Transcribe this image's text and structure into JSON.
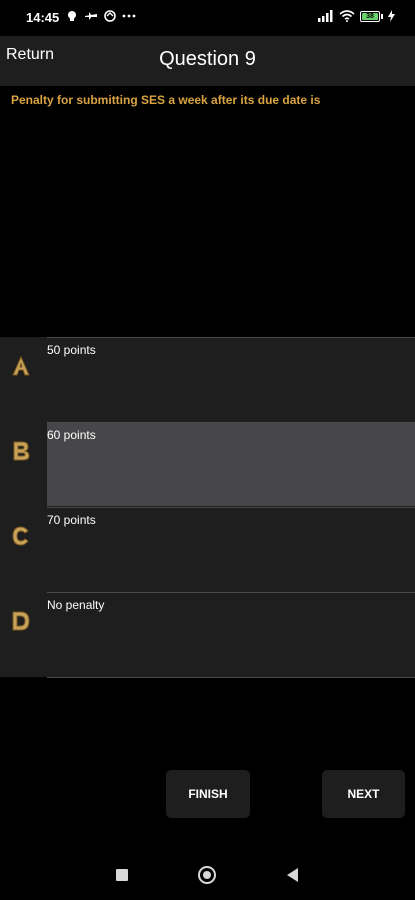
{
  "status_bar": {
    "time": "14:45",
    "battery_level": "38",
    "icons": [
      "notification-icon",
      "airplane-icon",
      "sync-icon",
      "more-icon",
      "signal-icon",
      "wifi-icon",
      "battery-icon",
      "charging-icon"
    ]
  },
  "header": {
    "return_label": "Return",
    "title": "Question 9"
  },
  "question": {
    "text": "Penalty for submitting SES a week after its due date is"
  },
  "answers": [
    {
      "letter": "A",
      "label": "50 points",
      "selected": false
    },
    {
      "letter": "B",
      "label": "60 points",
      "selected": true
    },
    {
      "letter": "C",
      "label": "70 points",
      "selected": false
    },
    {
      "letter": "D",
      "label": "No penalty",
      "selected": false
    }
  ],
  "actions": {
    "finish_label": "FINISH",
    "next_label": "NEXT"
  },
  "colors": {
    "background": "#000000",
    "panel": "#1e1e1e",
    "selected": "#47474a",
    "accent": "#d9a441"
  },
  "nav_bar": {
    "icons": [
      "recents-icon",
      "home-icon",
      "back-icon"
    ]
  }
}
